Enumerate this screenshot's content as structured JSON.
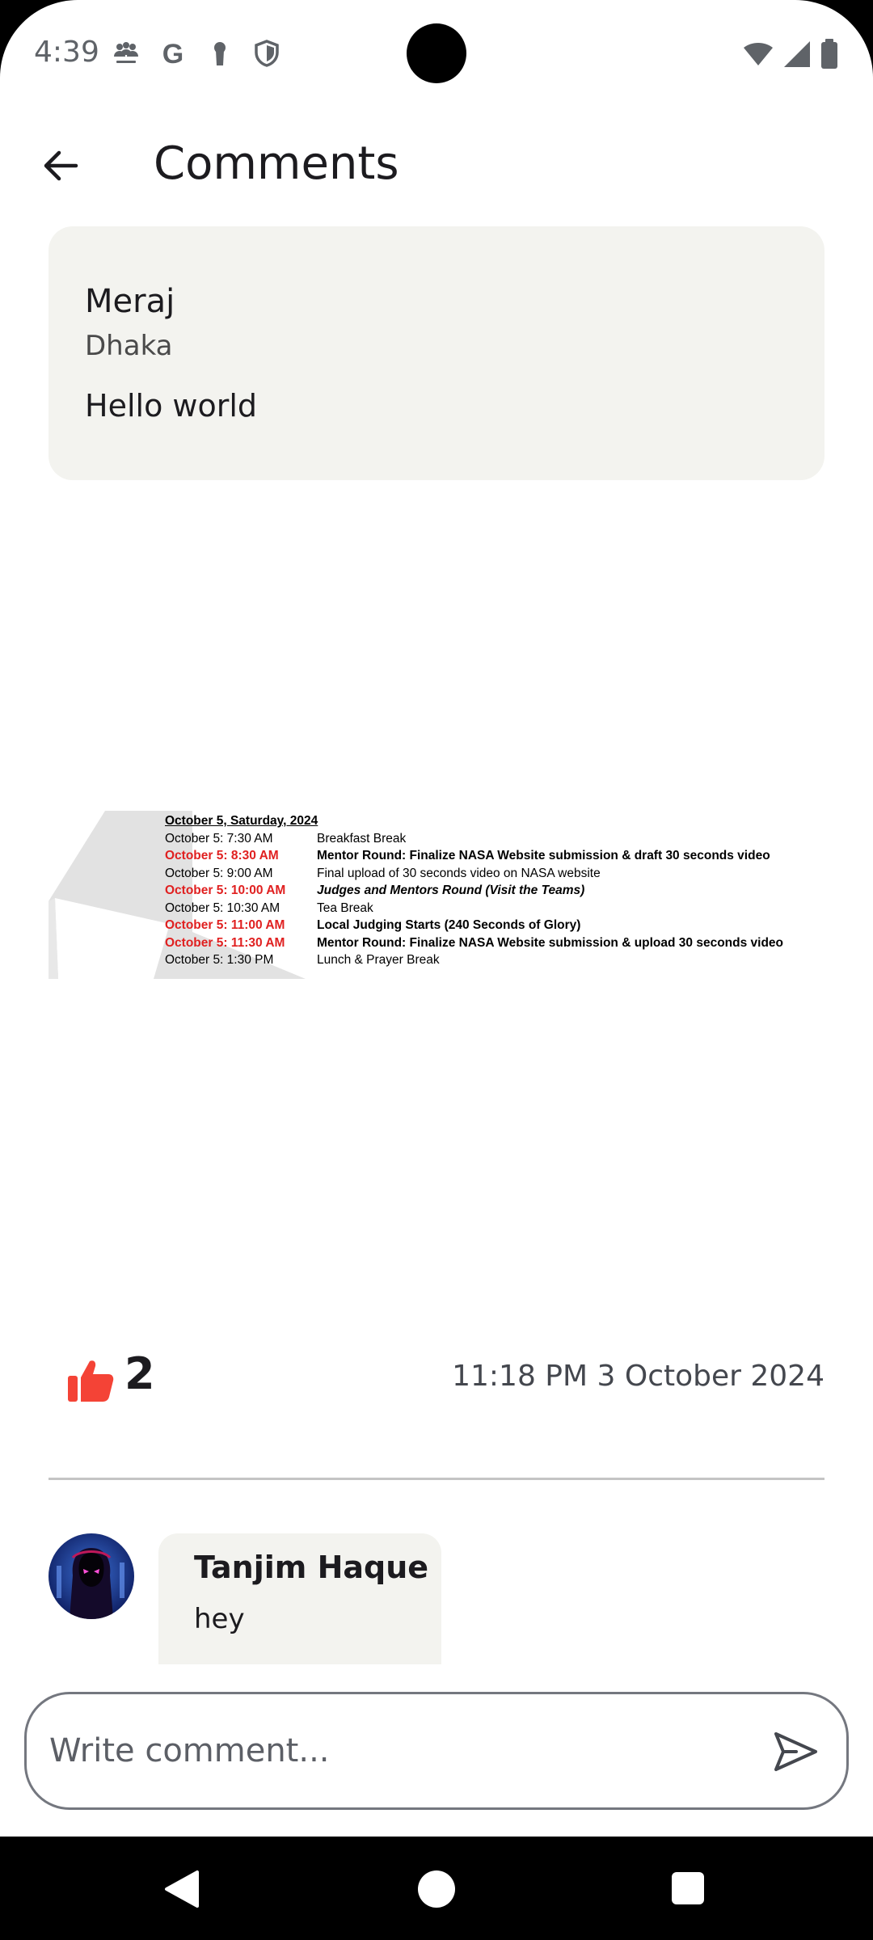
{
  "status_bar": {
    "time": "4:39",
    "left_icons": [
      "teams-icon",
      "google-icon",
      "keyhole-icon",
      "shield-icon"
    ],
    "right_icons": [
      "wifi-icon",
      "signal-icon",
      "battery-icon"
    ]
  },
  "header": {
    "title": "Comments"
  },
  "post": {
    "author": "Meraj",
    "location": "Dhaka",
    "text": "Hello world",
    "image": {
      "heading": "October 5, Saturday, 2024",
      "rows": [
        {
          "time": "October 5: 7:30 AM",
          "highlight": false,
          "desc": "Breakfast Break",
          "style": "normal"
        },
        {
          "time": "October 5: 8:30 AM",
          "highlight": true,
          "desc": "Mentor Round: Finalize NASA Website submission & draft 30 seconds video",
          "style": "bold"
        },
        {
          "time": "October 5: 9:00 AM",
          "highlight": false,
          "desc": "Final upload of 30 seconds video on NASA website",
          "style": "normal"
        },
        {
          "time": "October 5: 10:00 AM",
          "highlight": true,
          "desc": "Judges and Mentors Round (Visit the Teams)",
          "style": "bolditalic"
        },
        {
          "time": "October 5: 10:30 AM",
          "highlight": false,
          "desc": "Tea Break",
          "style": "normal"
        },
        {
          "time": "October 5: 11:00 AM",
          "highlight": true,
          "desc": "Local Judging Starts (240 Seconds of Glory)",
          "style": "bold"
        },
        {
          "time": "October 5: 11:30 AM",
          "highlight": true,
          "desc": "Mentor Round: Finalize NASA Website submission & upload 30 seconds video",
          "style": "bold"
        },
        {
          "time": "October 5: 1:30 PM",
          "highlight": false,
          "desc": "Lunch & Prayer Break",
          "style": "normal"
        }
      ]
    },
    "like_count": "2",
    "timestamp": "11:18 PM 3 October 2024"
  },
  "comments": [
    {
      "author": "Tanjim Haque",
      "text": "hey"
    }
  ],
  "composer": {
    "placeholder": "Write comment..."
  },
  "colors": {
    "like": "#f44336",
    "card_bg": "#f3f3ef",
    "highlight_time": "#e02020"
  }
}
